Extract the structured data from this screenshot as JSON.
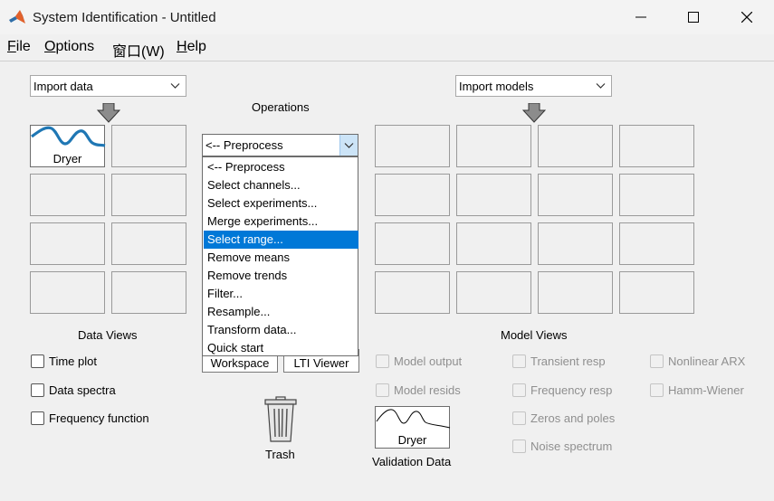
{
  "window": {
    "title": "System Identification - Untitled",
    "icon": "matlab-icon",
    "controls": [
      "minimize-icon",
      "maximize-icon",
      "close-icon"
    ]
  },
  "menu": {
    "file": "File",
    "options": "Options",
    "window": "窗口(W)",
    "help": "Help"
  },
  "import_data": {
    "value": "Import data"
  },
  "import_models": {
    "value": "Import models"
  },
  "operations": {
    "label": "Operations",
    "value": "<-- Preprocess",
    "options": [
      "<-- Preprocess",
      "Select channels...",
      "Select experiments...",
      "Merge experiments...",
      "Select range...",
      "Remove means",
      "Remove trends",
      "Filter...",
      "Resample...",
      "Transform data...",
      "Quick start"
    ],
    "highlighted_index": 4
  },
  "data_board": {
    "slot_label": "Dryer",
    "title": "Data Views"
  },
  "data_views": [
    {
      "label": "Time plot",
      "checked": false,
      "enabled": true
    },
    {
      "label": "Data spectra",
      "checked": false,
      "enabled": true
    },
    {
      "label": "Frequency function",
      "checked": false,
      "enabled": true
    }
  ],
  "buttons": {
    "workspace": "Workspace",
    "lti_viewer": "LTI Viewer"
  },
  "model_board": {
    "title": "Model Views"
  },
  "model_views": [
    {
      "label": "Model output",
      "enabled": false
    },
    {
      "label": "Model resids",
      "enabled": false
    },
    {
      "label": "Transient resp",
      "enabled": false
    },
    {
      "label": "Frequency resp",
      "enabled": false
    },
    {
      "label": "Zeros and poles",
      "enabled": false
    },
    {
      "label": "Noise spectrum",
      "enabled": false
    },
    {
      "label": "Nonlinear ARX",
      "enabled": false
    },
    {
      "label": "Hamm-Wiener",
      "enabled": false
    }
  ],
  "trash": {
    "label": "Trash"
  },
  "validation": {
    "slot_label": "Dryer",
    "title": "Validation Data"
  },
  "colors": {
    "accent": "#0078d7",
    "data_curve": "#1f77b4"
  }
}
